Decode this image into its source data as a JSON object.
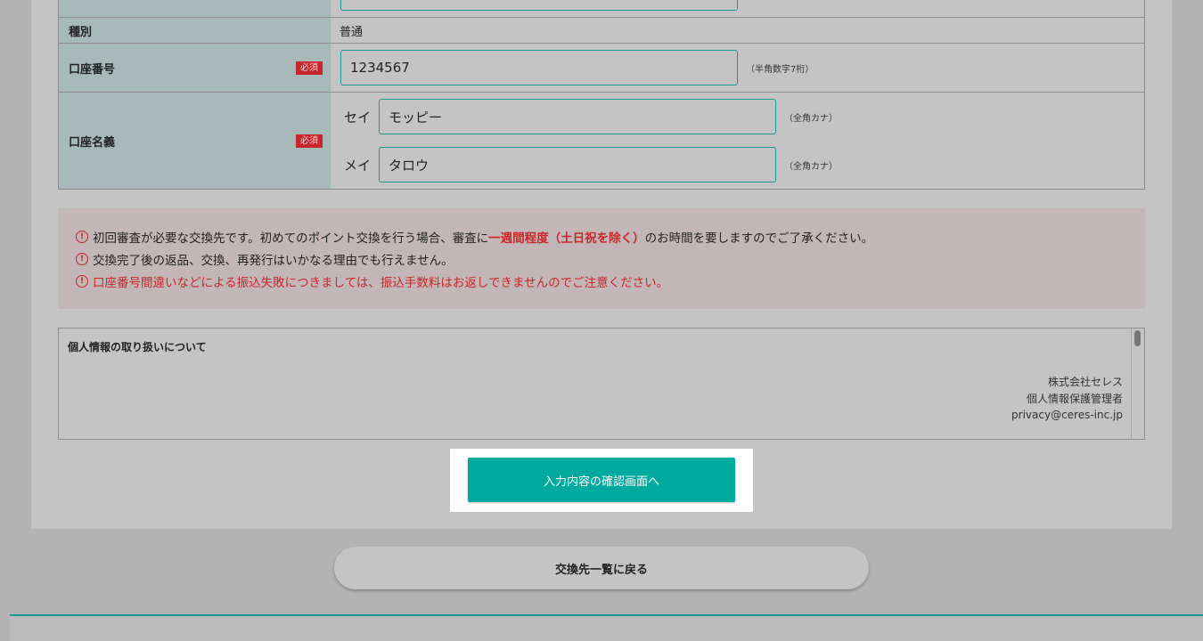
{
  "form": {
    "type_row": {
      "label": "種別",
      "value": "普通"
    },
    "account_number_row": {
      "label": "口座番号",
      "required": "必須",
      "value": "1234567",
      "hint": "（半角数字7桁）"
    },
    "account_name_row": {
      "label": "口座名義",
      "required": "必須",
      "sei": {
        "label": "セイ",
        "value": "モッピー",
        "hint": "（全角カナ）"
      },
      "mei": {
        "label": "メイ",
        "value": "タロウ",
        "hint": "（全角カナ）"
      }
    }
  },
  "notice": {
    "line1_pre": "初回審査が必要な交換先です。初めてのポイント交換を行う場合、審査に",
    "line1_emph": "一週間程度（土日祝を除く）",
    "line1_post": "のお時間を要しますのでご了承ください。",
    "line2": "交換完了後の返品、交換、再発行はいかなる理由でも行えません。",
    "line3": "口座番号間違いなどによる振込失敗につきましては、振込手数料はお返しできませんのでご注意ください。",
    "icon": "exclamation-circle-icon"
  },
  "privacy": {
    "title": "個人情報の取り扱いについて",
    "company": "株式会社セレス",
    "manager": "個人情報保護管理者",
    "email": "privacy@ceres-inc.jp"
  },
  "buttons": {
    "confirm": "入力内容の確認画面へ",
    "back": "交換先一覧に戻る"
  },
  "colors": {
    "accent": "#00aa9d",
    "required": "#c8262b",
    "border": "#1b9a8e"
  }
}
